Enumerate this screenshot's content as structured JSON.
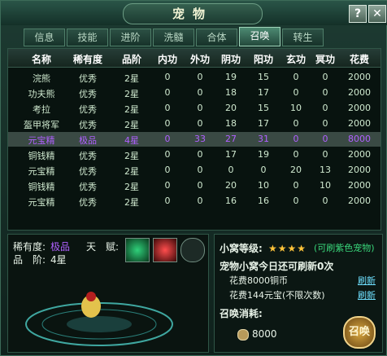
{
  "window": {
    "title": "宠物",
    "help_btn": "?",
    "close_btn": "✕"
  },
  "tabs": [
    {
      "label": "信息",
      "active": false
    },
    {
      "label": "技能",
      "active": false
    },
    {
      "label": "进阶",
      "active": false
    },
    {
      "label": "洗髓",
      "active": false
    },
    {
      "label": "合体",
      "active": false
    },
    {
      "label": "召唤",
      "active": true
    },
    {
      "label": "转生",
      "active": false
    }
  ],
  "table": {
    "headers": [
      "名称",
      "稀有度",
      "品阶",
      "内功",
      "外功",
      "阴功",
      "阳功",
      "玄功",
      "冥功",
      "花费"
    ],
    "rows": [
      [
        "浣熊",
        "优秀",
        "2星",
        "0",
        "0",
        "19",
        "15",
        "0",
        "0",
        "2000"
      ],
      [
        "功夫熊",
        "优秀",
        "2星",
        "0",
        "0",
        "18",
        "17",
        "0",
        "0",
        "2000"
      ],
      [
        "考拉",
        "优秀",
        "2星",
        "0",
        "0",
        "20",
        "15",
        "10",
        "0",
        "2000"
      ],
      [
        "盔甲将军",
        "优秀",
        "2星",
        "0",
        "0",
        "18",
        "17",
        "0",
        "0",
        "2000"
      ],
      [
        "元宝精",
        "极品",
        "4星",
        "0",
        "33",
        "27",
        "31",
        "0",
        "0",
        "8000"
      ],
      [
        "铜钱精",
        "优秀",
        "2星",
        "0",
        "0",
        "17",
        "19",
        "0",
        "0",
        "2000"
      ],
      [
        "元宝精",
        "优秀",
        "2星",
        "0",
        "0",
        "0",
        "0",
        "20",
        "13",
        "2000"
      ],
      [
        "铜钱精",
        "优秀",
        "2星",
        "0",
        "0",
        "20",
        "10",
        "0",
        "10",
        "2000"
      ],
      [
        "元宝精",
        "优秀",
        "2星",
        "0",
        "0",
        "16",
        "16",
        "0",
        "0",
        "2000"
      ]
    ],
    "selected_index": 4
  },
  "pet_info": {
    "rarity_label": "稀有度:",
    "rarity_value": "极品",
    "grade_label": "品　阶:",
    "grade_value": "4星",
    "talent_label": "天　赋:"
  },
  "summon_panel": {
    "den_level_label": "小窝等级:",
    "stars": "★★★★",
    "den_note": "(可刷紫色宠物)",
    "refresh_text": "宠物小窝今日还可刷新0次",
    "cost_copper": "花费8000铜币",
    "cost_ingot": "花费144元宝(不限次数)",
    "refresh_link": "刷新",
    "summon_cost_label": "召唤消耗:",
    "summon_cost_value": "8000",
    "summon_button": "召唤"
  },
  "colors": {
    "selected_text": "#b060ff",
    "star": "#ffc43a",
    "link": "#6fe0ff"
  }
}
